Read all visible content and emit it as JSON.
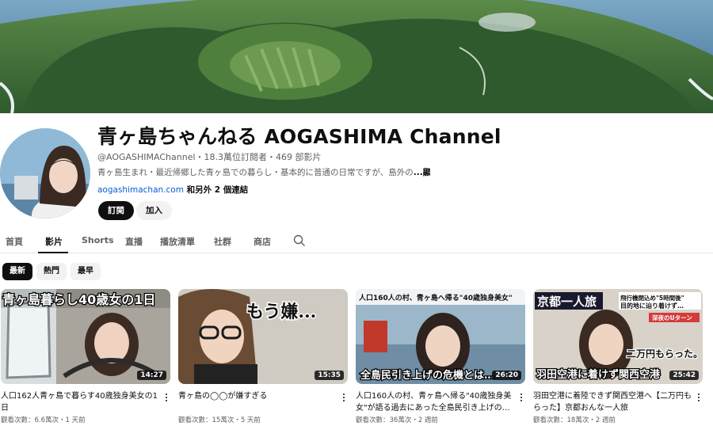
{
  "channel": {
    "title": "青ヶ島ちゃんねる AOGASHIMA Channel",
    "meta": "@AOGASHIMAChannel・18.3萬位訂閱者・469 部影片",
    "description": "青ヶ島生まれ・最近帰郷した青ヶ島での暮らし・基本的に普通の日常ですが、島外の",
    "more_label": "...顯示更多",
    "link": "aogashimachan.com",
    "extra_links": " 和另外 2 個連結",
    "subscribe_label": "訂閱",
    "join_label": "加入"
  },
  "tabs": [
    {
      "label": "首頁",
      "active": false
    },
    {
      "label": "影片",
      "active": true
    },
    {
      "label": "Shorts",
      "active": false
    },
    {
      "label": "直播",
      "active": false
    },
    {
      "label": "播放清單",
      "active": false
    },
    {
      "label": "社群",
      "active": false
    },
    {
      "label": "商店",
      "active": false
    }
  ],
  "chips": [
    {
      "label": "最新",
      "active": true
    },
    {
      "label": "熱門",
      "active": false
    },
    {
      "label": "最早",
      "active": false
    }
  ],
  "videos": [
    {
      "thumb_text": "青ヶ島暮らし40歳女の1日",
      "duration": "14:27",
      "title": "人口162人青ヶ島で暮らす40歳独身美女の1日",
      "meta": "觀看次數：6.6萬次・1 天前"
    },
    {
      "thumb_text": "もう嫌...",
      "duration": "15:35",
      "title": "青ヶ島の◯◯が嫌すぎる",
      "meta": "觀看次數：15萬次・5 天前"
    },
    {
      "thumb_text_top": "人口160人の村、青ヶ島へ帰る\"40歳独身美女\"",
      "thumb_text_bottom": "全島民引き上げの危機とは…",
      "duration": "26:20",
      "title": "人口160人の村、青ヶ島へ帰る\"40歳独身美女\"が語る過去にあった全島民引き上げの…",
      "meta": "觀看次數：36萬次・2 週前"
    },
    {
      "thumb_text_left": "京都一人旅",
      "thumb_text_right1": "飛行機閉込め\"5時間後\"",
      "thumb_text_right2": "目的地に辿り着けず…",
      "thumb_text_right3": "深夜のUターン",
      "thumb_text_mid": "二万円もらった。",
      "thumb_text_bottom": "羽田空港に着けず関西空港",
      "duration": "25:42",
      "title": "羽田空港に着陸できず関西空港へ【二万円もらった】京都おんな一人旅",
      "meta": "觀看次數：18萬次・2 週前"
    }
  ],
  "colors": {
    "accent": "#0f0f0f",
    "link": "#065fd4",
    "muted": "#606060",
    "chip_bg": "#f2f2f2"
  }
}
